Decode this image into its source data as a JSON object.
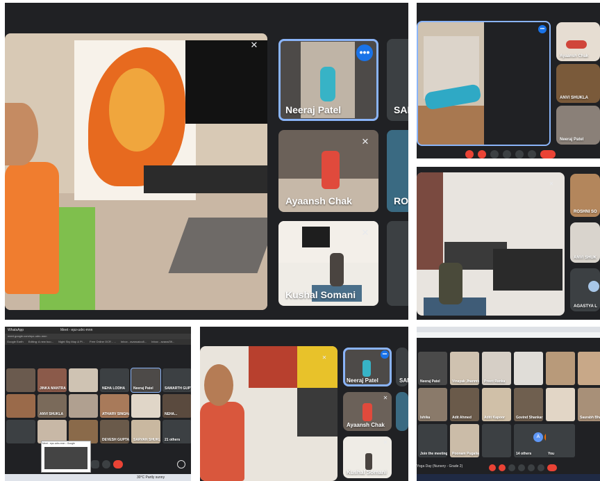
{
  "panel1": {
    "tiles": [
      {
        "name": "Neeraj Patel"
      },
      {
        "name": "SAI"
      },
      {
        "name": "Ayaansh Chak"
      },
      {
        "name": "RO"
      },
      {
        "name": "Kushal Somani"
      }
    ]
  },
  "panel2": {
    "tiles": [
      {
        "name": "Ayaansh Chak"
      },
      {
        "name": "ANVI SHUKLA"
      },
      {
        "name": "Neeraj Patel"
      }
    ]
  },
  "panel3": {
    "tiles": [
      {
        "name": "ROSHNI SO"
      },
      {
        "name": "ANVI SHUK"
      },
      {
        "name": "AGASTYA L"
      }
    ]
  },
  "panel4": {
    "tab1": "WhatsApp",
    "tab2": "Meet - epz-udrc-mnn",
    "address": "meet.google.com/epz-udrc-mnn",
    "bookmarks": [
      "Google Earth",
      "Editing: A new boo...",
      "Night Sky Map & Pl...",
      "Free Online OCR - ...",
      "Inbox - avanoaico8...",
      "Inbox - avana/39..."
    ],
    "tiles": [
      "",
      "JINKA MANTRA",
      "",
      "NEHA LODHA",
      "Neeraj Patel",
      "SAMARTH GUPTA",
      "",
      "ANVI SHUKLA",
      "",
      "ATHARV SINGHAL",
      "",
      "NEHA...",
      "",
      "",
      "",
      "DEVESH GUPTA",
      "SARVAN SHUKL...",
      "21 others"
    ],
    "pip_title": "Meet - epz-udrc-mnn - Google",
    "weather": "30°C Partly sunny"
  },
  "panel5": {
    "tiles": [
      {
        "name": "Neeraj Patel"
      },
      {
        "name": "SAM"
      },
      {
        "name": "Ayaansh Chak"
      },
      {
        "name": "Kushal Somani"
      }
    ]
  },
  "panel6": {
    "tiles": [
      "Neeraj Patel",
      "Vinayak Jhanmiwal",
      "Preeti Ranka",
      "",
      "",
      "",
      "Ishika",
      "Adit Ahmed",
      "Aditi Kapoor",
      "Govind Shankar",
      "",
      "Saurabh Bhatia",
      "Join the meeting",
      "Poonam Pugalia",
      "",
      "14 others",
      "You"
    ],
    "meeting_title": "Yoga Day (Nursery - Grade 2)",
    "avatars": [
      "A",
      "S"
    ]
  }
}
